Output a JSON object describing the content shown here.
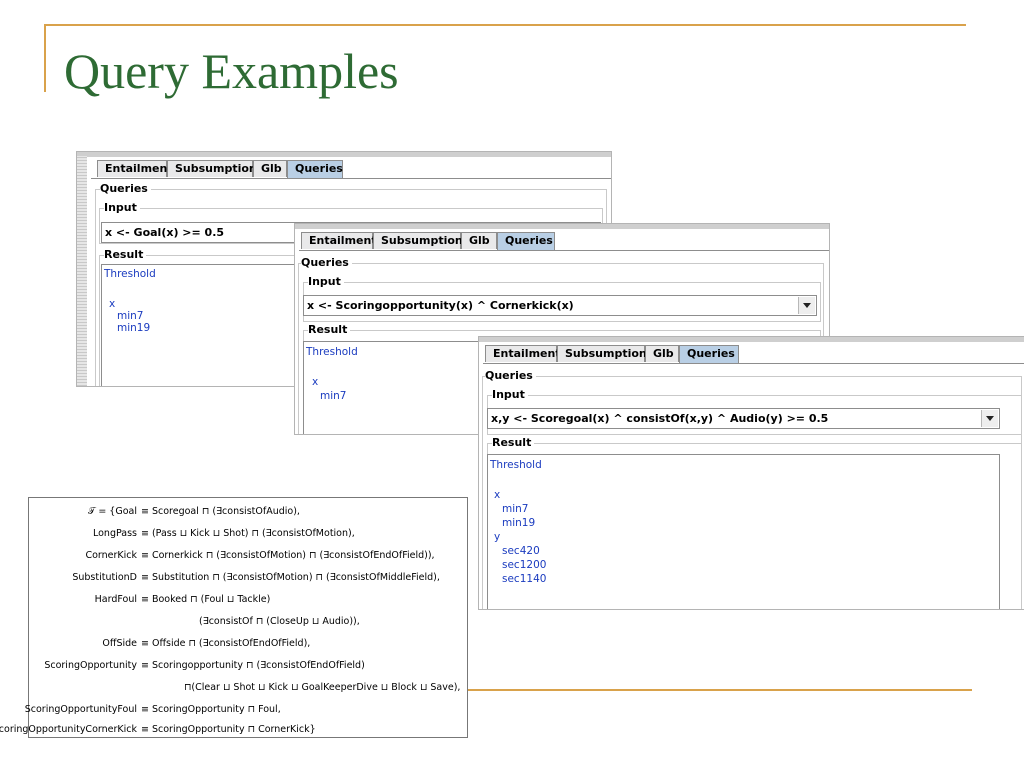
{
  "slide": {
    "title": "Query Examples"
  },
  "tabs": [
    "Entailment",
    "Subsumption",
    "Glb",
    "Queries"
  ],
  "labels": {
    "queries": "Queries",
    "input": "Input",
    "result": "Result"
  },
  "panels": [
    {
      "input": "x <- Goal(x) >= 0.5",
      "result": [
        "Threshold",
        "",
        "x",
        "  min7",
        "  min19"
      ]
    },
    {
      "input": "x <- Scoringopportunity(x) ^ Cornerkick(x)",
      "result": [
        "Threshold",
        "",
        "x",
        "  min7"
      ]
    },
    {
      "input": "x,y <- Scoregoal(x) ^ consistOf(x,y) ^ Audio(y) >= 0.5",
      "result": [
        "Threshold",
        "",
        "x",
        "  min7",
        "  min19",
        "y",
        "  sec420",
        "  sec1200",
        "  sec1140"
      ]
    }
  ],
  "formula": {
    "lines": [
      {
        "lhs": "𝒯 = {Goal",
        "rhs": "≡ Scoregoal ⊓ (∃consistOfAudio),"
      },
      {
        "lhs": "LongPass",
        "rhs": "≡ (Pass ⊔ Kick ⊔ Shot) ⊓ (∃consistOfMotion),"
      },
      {
        "lhs": "CornerKick",
        "rhs": "≡ Cornerkick ⊓ (∃consistOfMotion) ⊓ (∃consistOfEndOfField)),"
      },
      {
        "lhs": "SubstitutionD",
        "rhs": "≡ Substitution ⊓ (∃consistOfMotion) ⊓ (∃consistOfMiddleField),"
      },
      {
        "lhs": "HardFoul",
        "rhs": "≡ Booked ⊓ (Foul ⊔ Tackle)"
      },
      {
        "lhs": "",
        "rhs": "(∃consistOf ⊓ (CloseUp ⊔ Audio)),"
      },
      {
        "lhs": "OffSide",
        "rhs": "≡ Offside ⊓ (∃consistOfEndOfField),"
      },
      {
        "lhs": "ScoringOpportunity",
        "rhs": "≡ Scoringopportunity ⊓ (∃consistOfEndOfField)"
      },
      {
        "lhs": "",
        "rhs": "⊓(Clear ⊔ Shot ⊔ Kick ⊔ GoalKeeperDive ⊔ Block ⊔ Save),"
      },
      {
        "lhs": "ScoringOpportunityFoul",
        "rhs": "≡ ScoringOpportunity ⊓ Foul,"
      },
      {
        "lhs": "ScoringOpportunityCornerKick",
        "rhs": "≡ ScoringOpportunity ⊓ CornerKick}"
      }
    ]
  }
}
